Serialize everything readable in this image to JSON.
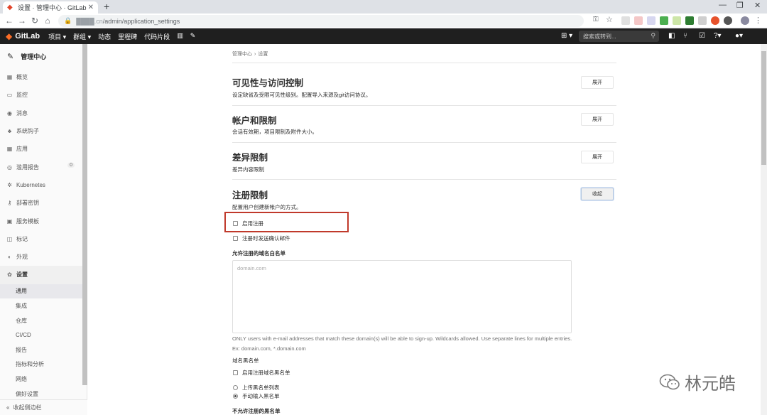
{
  "browser": {
    "tab_title": "设置 · 管理中心 · GitLab",
    "url_host": "████.cn",
    "url_path": "/admin/application_settings"
  },
  "header": {
    "logo_text": "GitLab",
    "nav": [
      "项目 ▾",
      "群组 ▾",
      "动态",
      "里程碑",
      "代码片段",
      "",
      ""
    ],
    "search_placeholder": "搜索或转到..."
  },
  "sidebar": {
    "context_title": "管理中心",
    "items": [
      {
        "label": "概览",
        "icon": "▦"
      },
      {
        "label": "监控",
        "icon": "▭"
      },
      {
        "label": "消息",
        "icon": "◉"
      },
      {
        "label": "系统钩子",
        "icon": "♣"
      },
      {
        "label": "应用",
        "icon": "▦"
      },
      {
        "label": "滥用报告",
        "icon": "◎",
        "count": "0"
      },
      {
        "label": "Kubernetes",
        "icon": "✲"
      },
      {
        "label": "部署密钥",
        "icon": "⚷"
      },
      {
        "label": "服务模板",
        "icon": "▣"
      },
      {
        "label": "标记",
        "icon": "◫"
      },
      {
        "label": "外观",
        "icon": "◐"
      },
      {
        "label": "设置",
        "icon": "✿"
      }
    ],
    "settings_sub": [
      "通用",
      "集成",
      "仓库",
      "CI/CD",
      "报告",
      "指标和分析",
      "网络",
      "偏好设置"
    ],
    "collapse_label": "收起侧边栏"
  },
  "breadcrumb": {
    "parent": "管理中心",
    "current": "设置"
  },
  "sections": [
    {
      "title": "可见性与访问控制",
      "desc": "设定缺省及受限可见性级别。配置导入来源及git访问协议。",
      "button": "展开"
    },
    {
      "title": "帐户和限制",
      "desc": "会话有效期，项目限制及附件大小。",
      "button": "展开"
    },
    {
      "title": "差异限制",
      "desc": "差异内容限制",
      "button": "展开"
    },
    {
      "title": "注册限制",
      "desc": "配置用户创建新帐户的方式。",
      "button": "收起"
    }
  ],
  "signup": {
    "enable_signup": "启用注册",
    "send_confirmation": "注册时发送确认邮件",
    "whitelist_label": "允许注册的域名白名单",
    "whitelist_placeholder": "domain.com",
    "whitelist_help": "ONLY users with e-mail addresses that match these domain(s) will be able to sign-up. Wildcards allowed. Use separate lines for multiple entries. Ex: domain.com, *.domain.com",
    "blacklist_heading": "域名黑名单",
    "enable_blacklist": "启用注册域名黑名单",
    "upload_list": "上传黑名单列表",
    "manual_list": "手动输入黑名单",
    "blacklist_domains_label": "不允许注册的黑名单"
  },
  "watermark": {
    "text": "林元皓"
  }
}
